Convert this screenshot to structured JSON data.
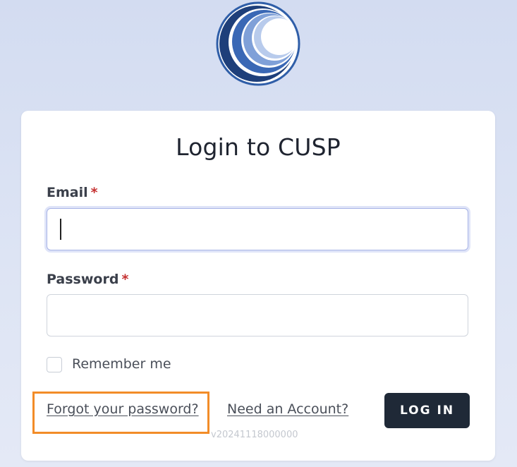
{
  "logo": {
    "icon": "cusp-logo-icon"
  },
  "login": {
    "title": "Login to CUSP",
    "email_label": "Email",
    "password_label": "Password",
    "required_mark": "*",
    "email_value": "",
    "password_value": "",
    "remember_label": "Remember me",
    "remember_checked": false,
    "forgot_link": "Forgot your password?",
    "account_link": "Need an Account?",
    "login_button": "LOG IN",
    "version": "v20241118000000"
  },
  "colors": {
    "button_bg": "#1f2937",
    "required": "#c53030",
    "highlight": "#f28c28",
    "logo_blue": "#2f5ea8"
  }
}
